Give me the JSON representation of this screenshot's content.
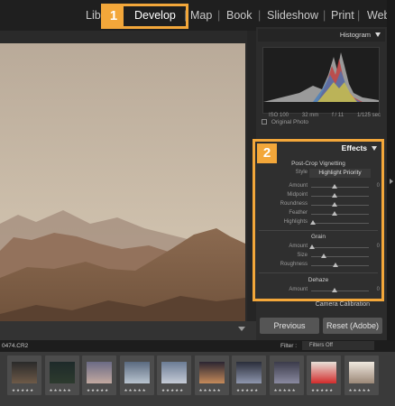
{
  "module_picker": {
    "items": [
      "Lib",
      "Develop",
      "Map",
      "Book",
      "Slideshow",
      "Print",
      "Web"
    ],
    "separator": "|",
    "active": "Develop",
    "callout_number": "1"
  },
  "histogram": {
    "title": "Histogram",
    "info": {
      "iso": "ISO 100",
      "focal": "32 mm",
      "aperture": "f / 11",
      "shutter": "1/125 sec"
    },
    "original_photo_label": "Original Photo"
  },
  "effects": {
    "callout_number": "2",
    "title": "Effects",
    "vignetting": {
      "title": "Post-Crop Vignetting",
      "style_label": "Style",
      "style_value": "Highlight Priority",
      "sliders": [
        {
          "label": "Amount",
          "value": "0",
          "pos": 0.4
        },
        {
          "label": "Midpoint",
          "value": "",
          "pos": 0.4
        },
        {
          "label": "Roundness",
          "value": "",
          "pos": 0.4
        },
        {
          "label": "Feather",
          "value": "",
          "pos": 0.4
        },
        {
          "label": "Highlights",
          "value": "",
          "pos": 0.03
        }
      ]
    },
    "grain": {
      "title": "Grain",
      "sliders": [
        {
          "label": "Amount",
          "value": "0",
          "pos": 0.02
        },
        {
          "label": "Size",
          "value": "",
          "pos": 0.22
        },
        {
          "label": "Roughness",
          "value": "",
          "pos": 0.42
        }
      ]
    },
    "dehaze": {
      "title": "Dehaze",
      "sliders": [
        {
          "label": "Amount",
          "value": "0",
          "pos": 0.4
        }
      ]
    }
  },
  "camera_calibration": "Camera Calibration",
  "buttons": {
    "previous": "Previous",
    "reset": "Reset (Adobe)"
  },
  "filmstrip": {
    "filename": "0474.CR2",
    "filter_label": "Filter :",
    "filter_value": "Filters Off",
    "ratings": [
      "★★★★★",
      "★★★★★",
      "★★★★★",
      "★★★★★",
      "★★★★★",
      "★★★★★",
      "★★★★★",
      "★★★★★",
      "★★★★★",
      "★★★★★"
    ]
  },
  "colors": {
    "callout": "#f3a73a",
    "panel": "#2c2c2c"
  }
}
